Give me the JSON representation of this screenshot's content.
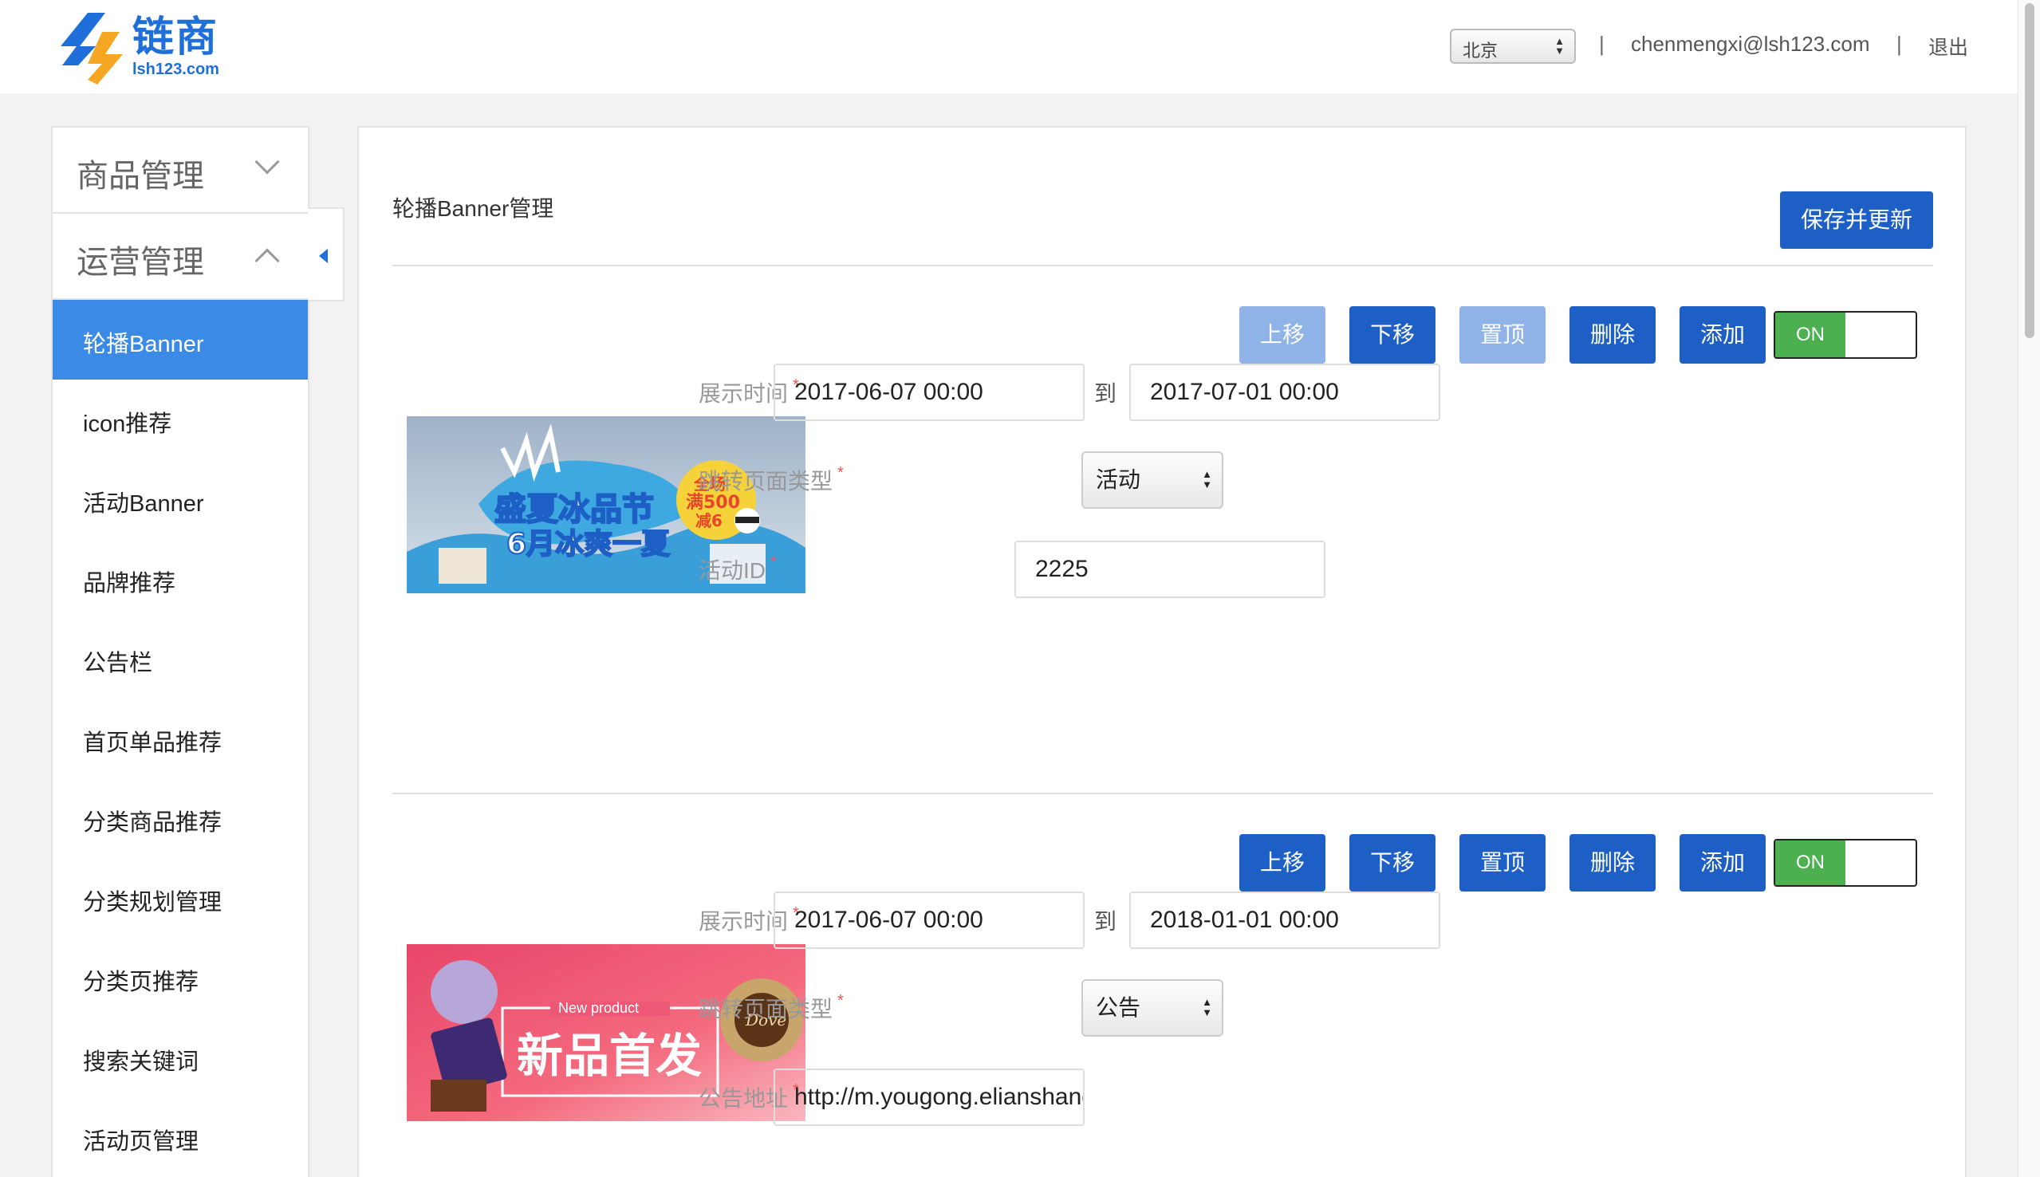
{
  "header": {
    "logo_name": "链商",
    "logo_url": "lsh123.com",
    "city": "北京",
    "separator": "|",
    "email": "chenmengxi@lsh123.com",
    "logout": "退出"
  },
  "sidebar": {
    "groups": [
      {
        "label": "商品管理",
        "expanded": false
      },
      {
        "label": "运营管理",
        "expanded": true
      }
    ],
    "items": [
      {
        "label": "轮播Banner",
        "active": true
      },
      {
        "label": "icon推荐"
      },
      {
        "label": "活动Banner"
      },
      {
        "label": "品牌推荐"
      },
      {
        "label": "公告栏"
      },
      {
        "label": "首页单品推荐"
      },
      {
        "label": "分类商品推荐"
      },
      {
        "label": "分类规划管理"
      },
      {
        "label": "分类页推荐"
      },
      {
        "label": "搜索关键词"
      },
      {
        "label": "活动页管理"
      }
    ]
  },
  "main": {
    "title": "轮播Banner管理",
    "save_label": "保存并更新",
    "buttons": {
      "up": "上移",
      "down": "下移",
      "top": "置顶",
      "delete": "删除",
      "add": "添加"
    },
    "toggle_on": "ON",
    "labels": {
      "display_time": "展示时间",
      "to": "到",
      "jump_type": "跳转页面类型",
      "activity_id": "活动ID",
      "notice_url": "公告地址",
      "required": "*"
    },
    "banners": [
      {
        "image_text": {
          "title_line1": "盛夏冰品节",
          "title_line2": "6月冰爽一夏",
          "badge_line1": "全场",
          "badge_line2": "满500",
          "badge_line3": "减6"
        },
        "start": "2017-06-07 00:00",
        "end": "2017-07-01 00:00",
        "jump_type": "活动",
        "extra_value": "2225",
        "toggle_on": true,
        "up_disabled": true,
        "top_disabled": true
      },
      {
        "image_text": {
          "subtitle": "New product",
          "title": "新品首发",
          "brand": "Dove"
        },
        "start": "2017-06-07 00:00",
        "end": "2018-01-01 00:00",
        "jump_type": "公告",
        "extra_value": "http://m.yougong.elianshang",
        "toggle_on": true,
        "up_disabled": false,
        "top_disabled": false
      }
    ]
  },
  "colors": {
    "brand": "#1e6fd9",
    "button": "#1e5fc6",
    "button_disabled": "#8fb3e6",
    "active_nav": "#3b8ae6",
    "toggle_on": "#4cb050",
    "required": "#e55555"
  }
}
